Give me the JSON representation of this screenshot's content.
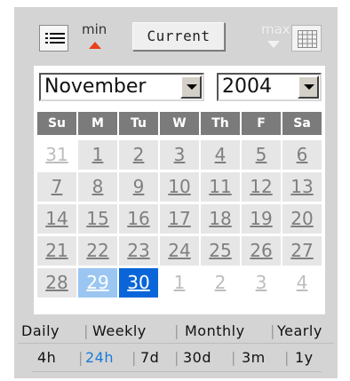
{
  "toolbar": {
    "min_label": "min",
    "current_label": "Current",
    "max_label": "max",
    "icons": [
      "list-icon",
      "min-arrow-icon",
      "max-arrow-icon",
      "grid-icon"
    ]
  },
  "calendar": {
    "month": "November",
    "year": "2004",
    "weekdays": [
      "Su",
      "M",
      "Tu",
      "W",
      "Th",
      "F",
      "Sa"
    ],
    "weeks": [
      [
        "31",
        "1",
        "2",
        "3",
        "4",
        "5",
        "6"
      ],
      [
        "7",
        "8",
        "9",
        "10",
        "11",
        "12",
        "13"
      ],
      [
        "14",
        "15",
        "16",
        "17",
        "18",
        "19",
        "20"
      ],
      [
        "21",
        "22",
        "23",
        "24",
        "25",
        "26",
        "27"
      ],
      [
        "28",
        "29",
        "30",
        "1",
        "2",
        "3",
        "4"
      ]
    ],
    "range_start_day": "29",
    "selected_day": "30"
  },
  "range_tabs": [
    "Daily",
    "Weekly",
    "Monthly",
    "Yearly"
  ],
  "span_tabs": [
    "4h",
    "24h",
    "7d",
    "30d",
    "3m",
    "1y"
  ],
  "active_span": "24h",
  "colors": {
    "panel_bg": "#d4d4d4",
    "header_bg": "#7b7b7b",
    "selected": "#0a66d8",
    "range_start": "#9ac6f1",
    "active_link": "#1a7bd6",
    "min_arrow": "#e8411a"
  }
}
